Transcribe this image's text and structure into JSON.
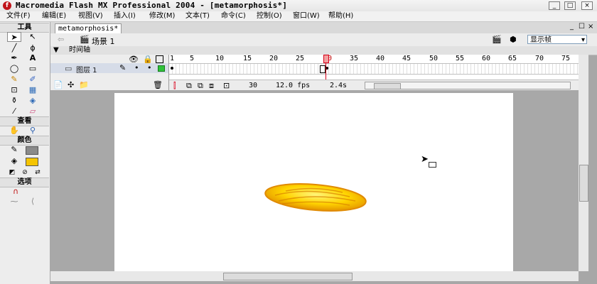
{
  "window": {
    "title": "Macromedia Flash MX Professional 2004 - [metamorphosis*]",
    "app_icon": "f",
    "buttons": [
      "_",
      "□",
      "×"
    ]
  },
  "menu": [
    "文件(F)",
    "编辑(E)",
    "视图(V)",
    "插入(I)",
    "修改(M)",
    "文本(T)",
    "命令(C)",
    "控制(O)",
    "窗口(W)",
    "帮助(H)"
  ],
  "tools": {
    "section_tools": "工具",
    "section_view": "查看",
    "section_colors": "颜色",
    "section_options": "选项"
  },
  "document": {
    "tab": "metamorphosis*",
    "scene": "场景 1",
    "view_select": "显示帧",
    "doc_buttons": [
      "_",
      "☐",
      "×"
    ]
  },
  "timeline": {
    "header": "时间轴",
    "layer_name": "图层 1",
    "ruler": [
      "1",
      "5",
      "10",
      "15",
      "20",
      "25",
      "30",
      "35",
      "40",
      "45",
      "50",
      "55",
      "60",
      "65",
      "70",
      "75"
    ],
    "current_frame": "30",
    "frame_rate": "12.0 fps",
    "elapsed": "2.4s"
  },
  "colors": {
    "accent": "#d9001b",
    "egg_light": "#ffe600",
    "egg_dark": "#e8a000"
  }
}
